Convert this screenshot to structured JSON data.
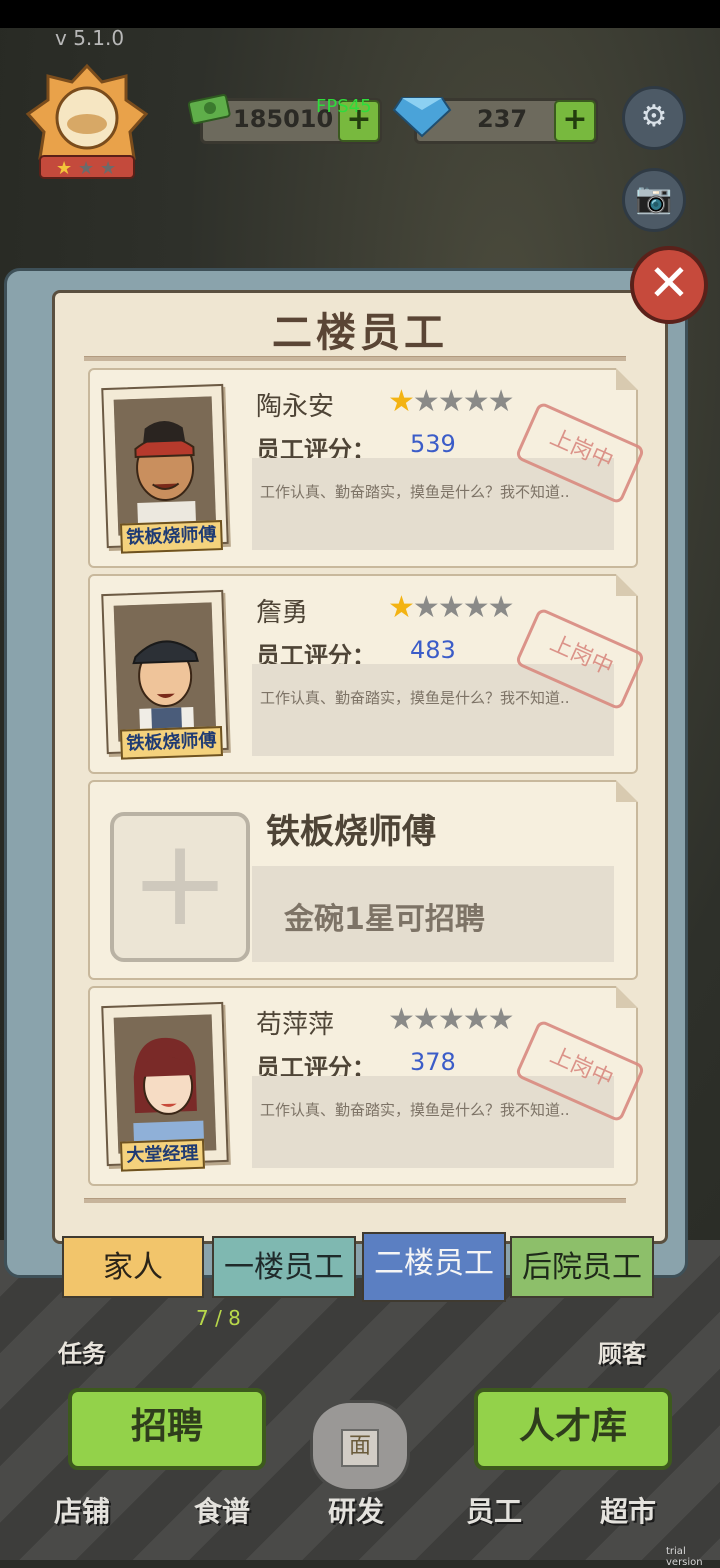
{
  "hud": {
    "version": "v 5.1.0",
    "fps": "FPS45",
    "cash": "185010",
    "gems": "237",
    "plus_symbol": "+",
    "settings_icon": "gear-icon",
    "camera_icon": "camera-icon"
  },
  "panel": {
    "title": "二楼员工",
    "close_icon": "close-icon",
    "close_symbol": "✕"
  },
  "staff": [
    {
      "name": "陶永安",
      "stars_filled": 1,
      "stars_total": 5,
      "score_label": "员工评分：",
      "score": "539",
      "description": "工作认真、勤奋踏实，摸鱼是什么？我不知道..",
      "status": "上岗中",
      "role": "铁板烧师傅"
    },
    {
      "name": "詹勇",
      "stars_filled": 1,
      "stars_total": 5,
      "score_label": "员工评分：",
      "score": "483",
      "description": "工作认真、勤奋踏实，摸鱼是什么？我不知道..",
      "status": "上岗中",
      "role": "铁板烧师傅"
    },
    {
      "name": "苟萍萍",
      "stars_filled": 0,
      "stars_total": 5,
      "score_label": "员工评分：",
      "score": "378",
      "description": "工作认真、勤奋踏实，摸鱼是什么？我不知道..",
      "status": "上岗中",
      "role": "大堂经理"
    }
  ],
  "empty_slot": {
    "title": "铁板烧师傅",
    "condition": "金碗1星可招聘",
    "plus_symbol": "+"
  },
  "tabs": [
    {
      "label": "家人",
      "color": "#f2c56b",
      "text_color": "#2b2418"
    },
    {
      "label": "一楼员工",
      "color": "#7fb8b1",
      "text_color": "#1f2a2a"
    },
    {
      "label": "二楼员工",
      "color": "#5b7fc2",
      "text_color": "#f5f5f5",
      "active": true
    },
    {
      "label": "后院员工",
      "color": "#8dbf6a",
      "text_color": "#1f2a1a"
    }
  ],
  "side": {
    "tasks_label": "任务",
    "customers_label": "顾客",
    "progress": "7 / 8"
  },
  "buttons": {
    "recruit": "招聘",
    "talent_pool": "人才库"
  },
  "nav": [
    "店铺",
    "食谱",
    "研发",
    "员工",
    "超市"
  ],
  "pot_label": "面",
  "watermark": "trial version"
}
